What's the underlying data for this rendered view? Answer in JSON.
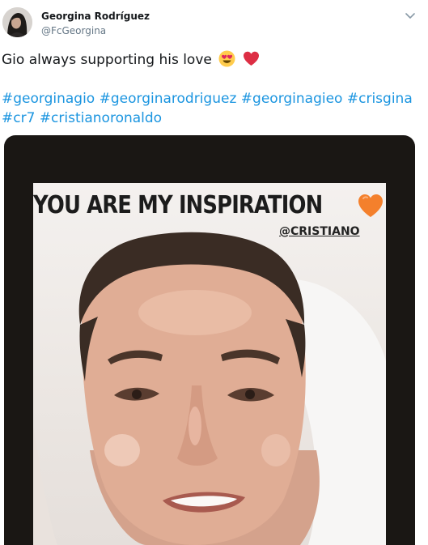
{
  "user": {
    "display_name": "Georgina Rodríguez",
    "handle": "@FcGeorgina",
    "avatar_icon": "profile-photo"
  },
  "menu": {
    "icon": "chevron-down-icon"
  },
  "tweet": {
    "text": "Gio always supporting his love",
    "emojis": [
      "smiling-face-with-heart-eyes-emoji",
      "red-heart-emoji"
    ],
    "hashtags_line1": [
      "#georginagio",
      "#georginarodriguez",
      "#georginagieo",
      "#crisgina"
    ],
    "hashtags_line2": [
      "#cr7",
      "#cristianoronaldo"
    ]
  },
  "media": {
    "story_title": "YOU ARE MY INSPIRATION",
    "story_emoji": "orange-heart-emoji",
    "story_mention": "@CRISTIANO"
  },
  "colors": {
    "hashtag": "#1b95e0",
    "handle": "#657786",
    "text": "#14171a",
    "media_frame": "#1a1714"
  }
}
